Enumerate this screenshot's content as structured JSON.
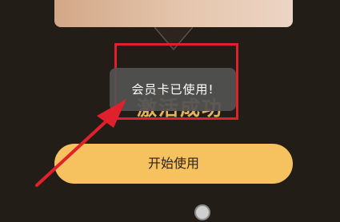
{
  "toast": {
    "message": "会员卡已使用!"
  },
  "partial_title": {
    "text": "激活成功"
  },
  "start_button": {
    "label": "开始使用"
  },
  "colors": {
    "background": "#231d18",
    "button": "#f6c25f",
    "annotation": "#e0212c",
    "toast": "#525252"
  },
  "icons": {
    "annotation_arrow": "red-arrow-icon"
  }
}
